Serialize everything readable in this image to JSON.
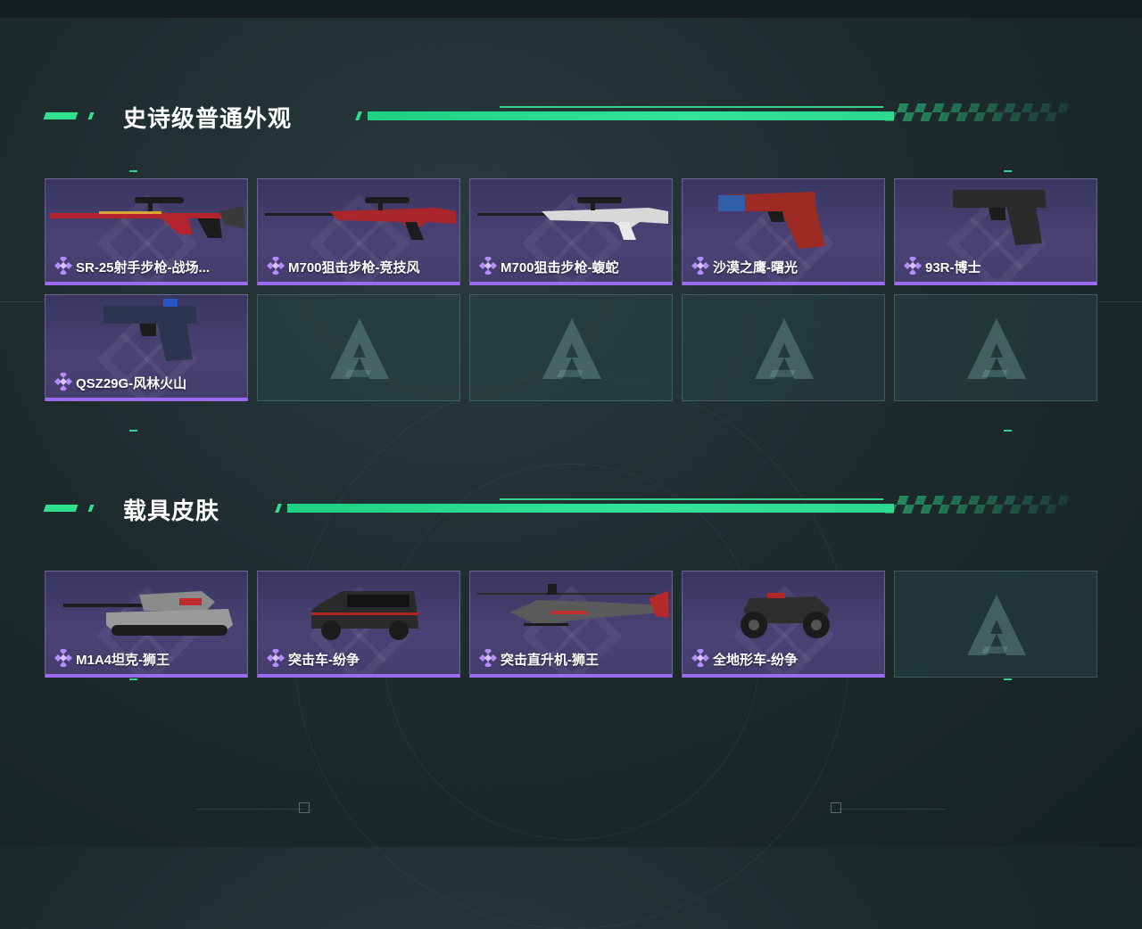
{
  "sections": [
    {
      "title": "史诗级普通外观",
      "items": [
        {
          "name": "SR-25射手步枪-战场...",
          "type": "rifle",
          "color": "#b3242c"
        },
        {
          "name": "M700狙击步枪-竞技风",
          "type": "sniper",
          "color": "#a8262c"
        },
        {
          "name": "M700狙击步枪-蝮蛇",
          "type": "sniper",
          "color": "#d8d8d8"
        },
        {
          "name": "沙漠之鹰-曙光",
          "type": "pistol-large",
          "color": "#9e2b23"
        },
        {
          "name": "93R-博士",
          "type": "pistol",
          "color": "#2b2b2b"
        },
        {
          "name": "QSZ29G-风林火山",
          "type": "pistol",
          "color": "#2c3550"
        }
      ],
      "empty_slots": 4
    },
    {
      "title": "载具皮肤",
      "items": [
        {
          "name": "M1A4坦克-狮王",
          "type": "tank",
          "color": "#8a8a8a"
        },
        {
          "name": "突击车-纷争",
          "type": "suv",
          "color": "#2a2a2a"
        },
        {
          "name": "突击直升机-狮王",
          "type": "helicopter",
          "color": "#5a5a5a"
        },
        {
          "name": "全地形车-纷争",
          "type": "atv",
          "color": "#2e2e2e"
        }
      ],
      "empty_slots": 1
    }
  ],
  "colors": {
    "accent_green": "#2fe08f",
    "card_purple": "#453d6c",
    "rarity_purple": "#9b6bf0",
    "empty_slot": "#264442"
  },
  "icons": {
    "rarity": "purple-diamond-icon",
    "empty_slot_logo": "triangle-logo-icon"
  }
}
